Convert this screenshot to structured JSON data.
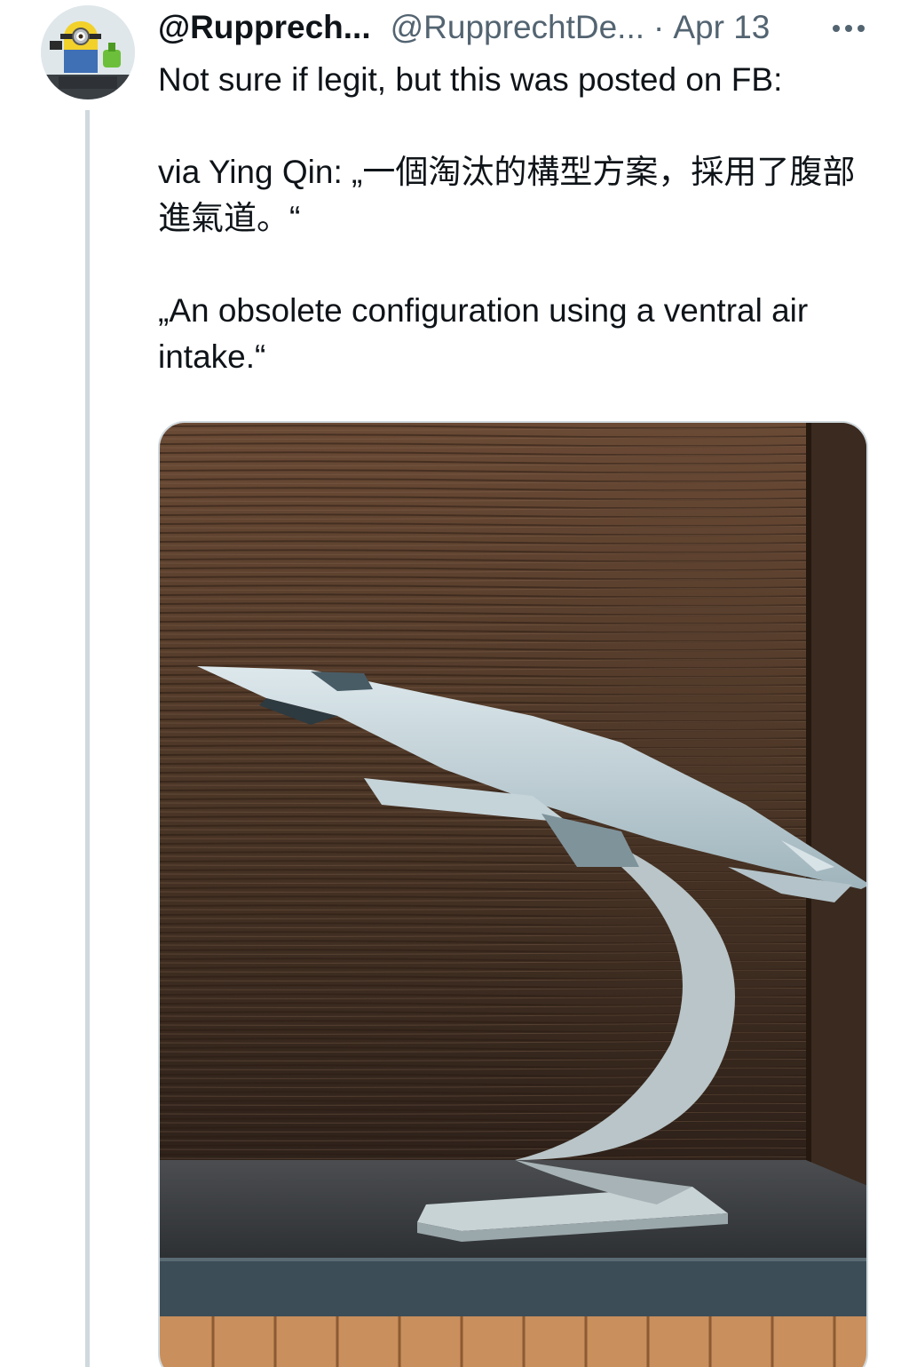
{
  "tweet": {
    "display_name": "@Rupprech...",
    "handle": "@RupprechtDe...",
    "separator": "·",
    "date": "Apr 13",
    "text_line_1": "Not sure if legit, but this was posted on FB:",
    "text_line_2": "via Ying Qin: „一個淘汰的構型方案，採用了腹部進氣道。“",
    "text_line_3": "„An obsolete configuration using a ventral air intake.“"
  },
  "icons": {
    "avatar": "minion-avatar-icon",
    "more": "more-options-icon"
  },
  "colors": {
    "text": "#0f1419",
    "secondary": "#536471",
    "thread_line": "#cfd9de"
  }
}
